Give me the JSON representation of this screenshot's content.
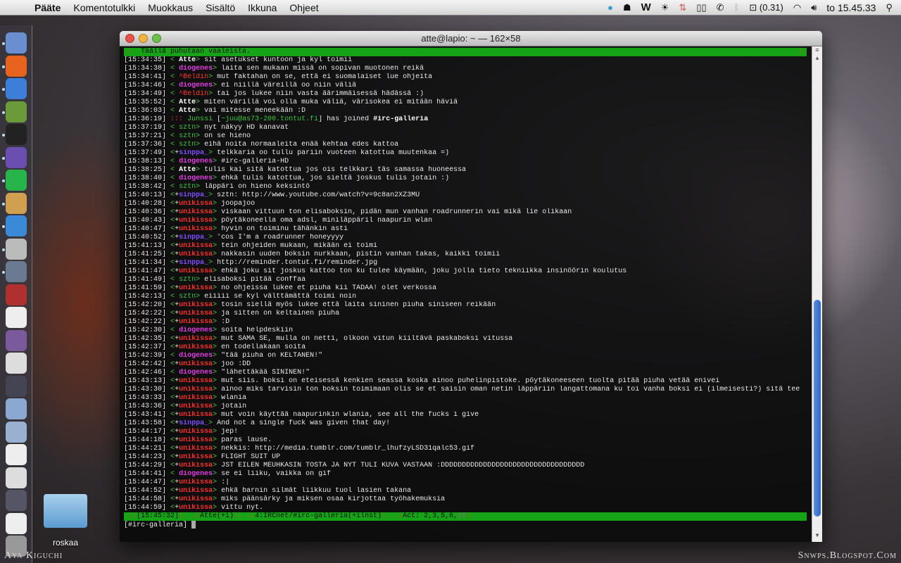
{
  "menubar": {
    "items": [
      "Pääte",
      "Komentotulkki",
      "Muokkaus",
      "Sisältö",
      "Ikkuna",
      "Ohjeet"
    ],
    "load": "(0.31)",
    "clock": "to 15.45.33"
  },
  "window": {
    "title": "atte@lapio: ~ — 162×58"
  },
  "topic": {
    "prefix": ".:",
    "text": "  Täällä puhutaan vaaleista.",
    "suffix": ":."
  },
  "messages": [
    [
      "15:34:35",
      " ",
      "Atte",
      "w",
      "sit asetukset kuntoon ja kyl toimii"
    ],
    [
      "15:34:38",
      " ",
      "diogenes",
      "m",
      "laita sen mukaan missä on sopivan muotonen reikä"
    ],
    [
      "15:34:41",
      " ",
      "^Beldin",
      "r",
      "mut faktahan on se, että ei suomalaiset lue ohjeita"
    ],
    [
      "15:34:46",
      " ",
      "diogenes",
      "m",
      "ei niillä väreillä oo niin väliä"
    ],
    [
      "15:34:49",
      " ",
      "^Beldin",
      "r",
      "tai jos lukee niin vasta äärimmäisessä hädässä :)"
    ],
    [
      "15:35:52",
      " ",
      "Atte",
      "w",
      "miten värillä voi olla muka väliä, värisokea ei mitään häviä"
    ],
    [
      "15:36:03",
      " ",
      "Atte",
      "w",
      "vai mitesse meneekään :D"
    ],
    [
      "15:37:19",
      " ",
      "sztn",
      "s",
      "nyt näkyy HD kanavat"
    ],
    [
      "15:37:21",
      " ",
      "sztn",
      "s",
      "on se hieno"
    ],
    [
      "15:37:36",
      " ",
      "sztn",
      "s",
      "eihä noita normaaleita enää kehtaa edes kattoa"
    ],
    [
      "15:37:49",
      "+",
      "sinppa_",
      "p",
      "telkkaria oo tullu pariin vuoteen katottua muutenkaa =)"
    ],
    [
      "15:38:13",
      " ",
      "diogenes",
      "m",
      "#irc-galleria-HD"
    ],
    [
      "15:38:25",
      " ",
      "Atte",
      "w",
      "tulis kai sitä katottua jos ois telkkari täs samassa huoneessa"
    ],
    [
      "15:38:40",
      " ",
      "diogenes",
      "m",
      "ehkä tulis katottua, jos sieltä joskus tulis jotain :)"
    ],
    [
      "15:38:42",
      " ",
      "sztn",
      "s",
      "läppäri on hieno keksintö"
    ],
    [
      "15:40:13",
      "+",
      "sinppa_",
      "p",
      "sztn: http://www.youtube.com/watch?v=9c8an2XZ3MU"
    ],
    [
      "15:40:28",
      "+",
      "unikissa",
      "u",
      "joopajoo"
    ],
    [
      "15:40:36",
      "+",
      "unikissa",
      "u",
      "viskaan vittuun ton elisaboksin, pidän mun vanhan roadrunnerin vai mikä lie olikaan"
    ],
    [
      "15:40:43",
      "+",
      "unikissa",
      "u",
      "pöytäkoneella oma adsl, miniläppäril naapurin wlan"
    ],
    [
      "15:40:47",
      "+",
      "unikissa",
      "u",
      "hyvin on toiminu tähänkin asti"
    ],
    [
      "15:40:52",
      "+",
      "sinppa_",
      "p",
      "'cos I'm a roadrunner honeyyyy"
    ],
    [
      "15:41:13",
      "+",
      "unikissa",
      "u",
      "tein ohjeiden mukaan, mikään ei toimi"
    ],
    [
      "15:41:25",
      "+",
      "unikissa",
      "u",
      "nakkasin uuden boksin nurkkaan, pistin vanhan takas, kaikki toimii"
    ],
    [
      "15:41:34",
      "+",
      "sinppa_",
      "p",
      "http://reminder.tontut.fi/reminder.jpg"
    ],
    [
      "15:41:47",
      "+",
      "unikissa",
      "u",
      "ehkä joku sit joskus kattoo ton ku tulee käymään, joku jolla tieto tekniikka insinöörin koulutus"
    ],
    [
      "15:41:49",
      " ",
      "sztn",
      "s",
      "elisaboksi pitää conffaa"
    ],
    [
      "15:41:59",
      "+",
      "unikissa",
      "u",
      "no ohjeissa lukee et piuha kii TADAA! olet verkossa"
    ],
    [
      "15:42:13",
      " ",
      "sztn",
      "s",
      "eiiiii se kyl välttämättä toimi noin"
    ],
    [
      "15:42:20",
      "+",
      "unikissa",
      "u",
      "tosin siellä myös lukee että laita sininen piuha siniseen reikään"
    ],
    [
      "15:42:22",
      "+",
      "unikissa",
      "u",
      "ja sitten on keltainen piuha"
    ],
    [
      "15:42:22",
      "+",
      "unikissa",
      "u",
      ":D"
    ],
    [
      "15:42:30",
      " ",
      "diogenes",
      "m",
      "soita helpdeskiin"
    ],
    [
      "15:42:35",
      "+",
      "unikissa",
      "u",
      "mut SAMA SE, mulla on netti, olkoon vitun kiiltävä paskaboksi vitussa"
    ],
    [
      "15:42:37",
      "+",
      "unikissa",
      "u",
      "en todellakaan soita"
    ],
    [
      "15:42:39",
      " ",
      "diogenes",
      "m",
      "\"tää piuha on KELTANEN!\""
    ],
    [
      "15:42:42",
      "+",
      "unikissa",
      "u",
      "joo :DD"
    ],
    [
      "15:42:46",
      " ",
      "diogenes",
      "m",
      "\"lähettäkää SININEN!\""
    ],
    [
      "15:43:13",
      "+",
      "unikissa",
      "u",
      "mut siis. boksi on eteisessä kenkien seassa koska ainoo puhelinpistoke. pöytäkoneeseen tuolta pitää piuha vetää enivei"
    ],
    [
      "15:43:30",
      "+",
      "unikissa",
      "u",
      "ainoo miks tarvisin ton boksin toimimaan olis se et saisin oman netin läppäriin langattomana ku toi vanha boksi ei (ilmeisesti?) sitä tee"
    ],
    [
      "15:43:33",
      "+",
      "unikissa",
      "u",
      "wlania"
    ],
    [
      "15:43:36",
      "+",
      "unikissa",
      "u",
      "jotain"
    ],
    [
      "15:43:41",
      "+",
      "unikissa",
      "u",
      "mut voin käyttää naapurinkin wlania, see all the fucks i give"
    ],
    [
      "15:43:58",
      "+",
      "sinppa_",
      "p",
      "And not a single fuck was given that day!"
    ],
    [
      "15:44:17",
      "+",
      "unikissa",
      "u",
      "jep!"
    ],
    [
      "15:44:18",
      "+",
      "unikissa",
      "u",
      "paras lause."
    ],
    [
      "15:44:21",
      "+",
      "unikissa",
      "u",
      "nekkis: http://media.tumblr.com/tumblr_lhufzyLSD31qalc53.gif"
    ],
    [
      "15:44:23",
      "+",
      "unikissa",
      "u",
      "FLIGHT SUIT UP"
    ],
    [
      "15:44:29",
      "+",
      "unikissa",
      "u",
      "JST EILEN MEUHKASIN TOSTA JA NYT TULI KUVA VASTAAN :DDDDDDDDDDDDDDDDDDDDDDDDDDDDDDDDDD"
    ],
    [
      "15:44:41",
      " ",
      "diogenes",
      "m",
      "se ei liiku, vaikka on gif"
    ],
    [
      "15:44:47",
      "+",
      "unikissa",
      "u",
      ":|"
    ],
    [
      "15:44:52",
      "+",
      "unikissa",
      "u",
      "ehkä barnin silmät liikkuu tuol lasien takana"
    ],
    [
      "15:44:58",
      "+",
      "unikissa",
      "u",
      "miks päänsärky ja miksen osaa kirjottaa työhakemuksia"
    ],
    [
      "15:44:59",
      "+",
      "unikissa",
      "u",
      "vittu nyt."
    ]
  ],
  "join": {
    "time": "15:36:19",
    "marker": ":::",
    "nick": "Junssi",
    "host": "~juu@as73-200.tontut.fi",
    "text": "has joined",
    "channel": "#irc-galleria"
  },
  "status": {
    "time": "[15:45:32]",
    "nick": "Atte(+i)",
    "window": "4:IRCnet/#irc-galleria(+ilnst)",
    "act": "Act: 2,3,5,6,",
    "act_hi": "10"
  },
  "input": {
    "prompt": "[#irc-galleria]"
  },
  "desktop": {
    "folder": "roskaa",
    "watermark_left": "Aya Kiguchi",
    "watermark_right": "Snwps.Blogspot.Com"
  }
}
